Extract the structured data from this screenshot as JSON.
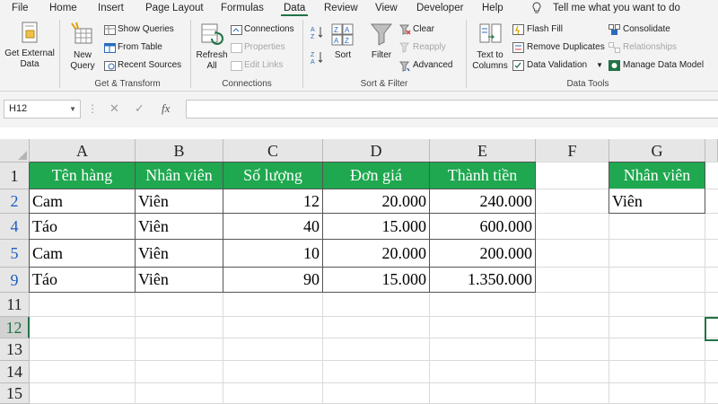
{
  "menu": {
    "tabs": [
      {
        "label": "File"
      },
      {
        "label": "Home"
      },
      {
        "label": "Insert"
      },
      {
        "label": "Page Layout"
      },
      {
        "label": "Formulas"
      },
      {
        "label": "Data"
      },
      {
        "label": "Review"
      },
      {
        "label": "View"
      },
      {
        "label": "Developer"
      },
      {
        "label": "Help"
      }
    ],
    "active_tab": "Data",
    "tell_me": "Tell me what you want to do"
  },
  "ribbon": {
    "get_transform": {
      "get_external_data": "Get External\nData",
      "new_query": "New\nQuery",
      "show_queries": "Show Queries",
      "from_table": "From Table",
      "recent_sources": "Recent Sources",
      "group_label": "Get & Transform"
    },
    "connections": {
      "refresh_all": "Refresh\nAll",
      "connections": "Connections",
      "properties": "Properties",
      "edit_links": "Edit Links",
      "group_label": "Connections"
    },
    "sort_filter": {
      "sort": "Sort",
      "filter": "Filter",
      "clear": "Clear",
      "reapply": "Reapply",
      "advanced": "Advanced",
      "group_label": "Sort & Filter"
    },
    "data_tools": {
      "text_to_columns": "Text to\nColumns",
      "flash_fill": "Flash Fill",
      "remove_duplicates": "Remove Duplicates",
      "data_validation": "Data Validation",
      "consolidate": "Consolidate",
      "relationships": "Relationships",
      "manage_data_model": "Manage Data Model",
      "group_label": "Data Tools"
    }
  },
  "formula_bar": {
    "name_box": "H12",
    "formula": ""
  },
  "sheet": {
    "columns": [
      "A",
      "B",
      "C",
      "D",
      "E",
      "F",
      "G"
    ],
    "row_numbers": [
      "1",
      "2",
      "4",
      "5",
      "9",
      "11",
      "12",
      "13",
      "14",
      "15"
    ],
    "table_headers": [
      "Tên hàng",
      "Nhân viên",
      "Số lượng",
      "Đơn giá",
      "Thành tiền"
    ],
    "rows": [
      [
        "Cam",
        "Viên",
        "12",
        "20.000",
        "240.000"
      ],
      [
        "Táo",
        "Viên",
        "40",
        "15.000",
        "600.000"
      ],
      [
        "Cam",
        "Viên",
        "10",
        "20.000",
        "200.000"
      ],
      [
        "Táo",
        "Viên",
        "90",
        "15.000",
        "1.350.000"
      ]
    ],
    "criteria_header": "Nhân viên",
    "criteria_value": "Viên"
  },
  "colors": {
    "header_fill": "#1fa84f",
    "accent": "#217346",
    "filtered_row_number": "#1f5dbf"
  }
}
